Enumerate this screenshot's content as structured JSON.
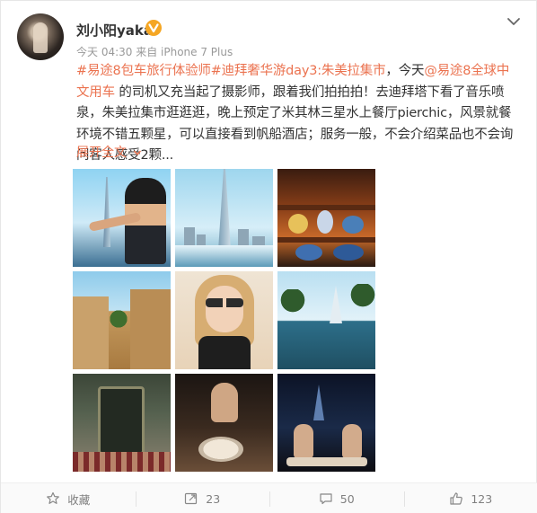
{
  "post": {
    "username": "刘小阳yaka",
    "meta": "今天 04:30 来自 iPhone 7 Plus",
    "text_segments": [
      {
        "text": "#易途8包车旅行体验师#迪拜奢华游day3:朱美拉集市",
        "style": "link"
      },
      {
        "text": "，今天",
        "style": "normal"
      },
      {
        "text": "@易途8全球中文用车",
        "style": "link"
      },
      {
        "text": " 的司机又充当起了摄影师，跟着我们拍拍拍！去迪拜塔下看了音乐喷泉，朱美拉集市逛逛逛，晚上预定了米其林三星水上餐厅pierchic，风景就餐环境不错五颗星，可以直接看到帆船酒店；服务一般，不会介绍菜品也不会询问客人感受2颗...",
        "style": "normal"
      }
    ],
    "expand_label": "展开全文",
    "expand_icon": "chevron-down-icon",
    "vip_icon": "vip-badge-icon",
    "menu_icon": "chevron-down-icon"
  },
  "footer": {
    "favorite": {
      "label": "收藏",
      "icon": "star-icon"
    },
    "repost": {
      "label": "23",
      "icon": "repost-icon"
    },
    "comment": {
      "label": "50",
      "icon": "comment-icon"
    },
    "like": {
      "label": "123",
      "icon": "thumbs-up-icon"
    }
  },
  "colors": {
    "link": "#eb7350",
    "text": "#333333",
    "meta": "#999999",
    "vip": "#f5a623"
  }
}
